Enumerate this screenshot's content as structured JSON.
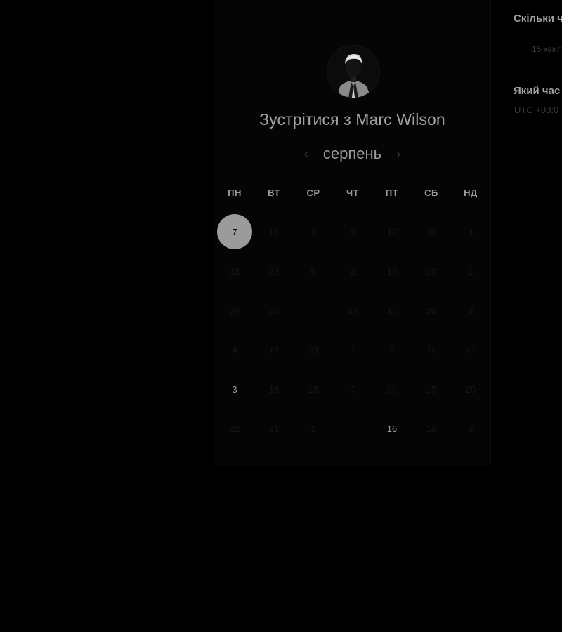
{
  "profile": {
    "heading": "Зустрітися з Marc Wilson",
    "avatar_icon": "avatar-portrait"
  },
  "calendar": {
    "month": "серпень",
    "prev_icon": "chevron-left-icon",
    "next_icon": "chevron-right-icon",
    "weekdays": [
      "ПН",
      "ВТ",
      "СР",
      "ЧТ",
      "ПТ",
      "СБ",
      "НД"
    ],
    "weeks": [
      [
        {
          "label": "7",
          "state": "selected"
        },
        {
          "label": "14",
          "state": "disabled"
        },
        {
          "label": "1",
          "state": "disabled"
        },
        {
          "label": "8",
          "state": "disabled"
        },
        {
          "label": "12",
          "state": "disabled"
        },
        {
          "label": "30",
          "state": "disabled"
        },
        {
          "label": "4",
          "state": "disabled"
        }
      ],
      [
        {
          "label": "18",
          "state": "disabled"
        },
        {
          "label": "29",
          "state": "disabled"
        },
        {
          "label": "5",
          "state": "disabled"
        },
        {
          "label": "2",
          "state": "disabled"
        },
        {
          "label": "19",
          "state": "disabled"
        },
        {
          "label": "10",
          "state": "disabled"
        },
        {
          "label": "1",
          "state": "disabled"
        }
      ],
      [
        {
          "label": "24",
          "state": "disabled"
        },
        {
          "label": "25",
          "state": "disabled"
        },
        {
          "label": "",
          "state": "disabled"
        },
        {
          "label": "14",
          "state": "disabled"
        },
        {
          "label": "15",
          "state": "disabled"
        },
        {
          "label": "20",
          "state": "disabled"
        },
        {
          "label": "3",
          "state": "disabled"
        }
      ],
      [
        {
          "label": "4",
          "state": "disabled"
        },
        {
          "label": "12",
          "state": "disabled"
        },
        {
          "label": "23",
          "state": "disabled"
        },
        {
          "label": "1",
          "state": "disabled"
        },
        {
          "label": "2",
          "state": "disabled"
        },
        {
          "label": "11",
          "state": "disabled"
        },
        {
          "label": "21",
          "state": "disabled"
        }
      ],
      [
        {
          "label": "3",
          "state": "available"
        },
        {
          "label": "18",
          "state": "disabled"
        },
        {
          "label": "15",
          "state": "disabled"
        },
        {
          "label": "7",
          "state": "disabled"
        },
        {
          "label": "30",
          "state": "disabled"
        },
        {
          "label": "15",
          "state": "disabled"
        },
        {
          "label": "20",
          "state": "disabled"
        }
      ],
      [
        {
          "label": "22",
          "state": "disabled"
        },
        {
          "label": "21",
          "state": "disabled"
        },
        {
          "label": "1",
          "state": "disabled"
        },
        {
          "label": "",
          "state": "disabled"
        },
        {
          "label": "16",
          "state": "available"
        },
        {
          "label": "15",
          "state": "disabled"
        },
        {
          "label": "3",
          "state": "disabled"
        }
      ]
    ]
  },
  "side": {
    "duration_question": "Скільки ч",
    "duration_value": "15 хвил",
    "timezone_question": "Який час",
    "timezone_value": "UTC +03:0"
  },
  "colors": {
    "background": "#000000",
    "panel": "#050505",
    "selected": "#9b9b9b",
    "text_available": "#9a9a9a",
    "text_disabled": "#151515"
  }
}
